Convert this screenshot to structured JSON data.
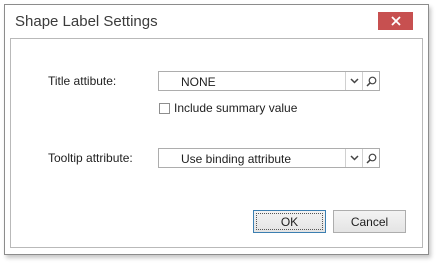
{
  "dialog": {
    "title": "Shape Label Settings",
    "close_icon": "close-icon",
    "close_color": "#c75050"
  },
  "title_attribute": {
    "label": "Title attibute:",
    "value": "NONE",
    "dropdown_icon": "chevron-down-icon",
    "search_icon": "search-icon"
  },
  "include_summary": {
    "label": "Include summary value",
    "checked": false
  },
  "tooltip_attribute": {
    "label": "Tooltip attribute:",
    "value": "Use binding attribute",
    "dropdown_icon": "chevron-down-icon",
    "search_icon": "search-icon"
  },
  "buttons": {
    "ok_label": "OK",
    "cancel_label": "Cancel"
  }
}
